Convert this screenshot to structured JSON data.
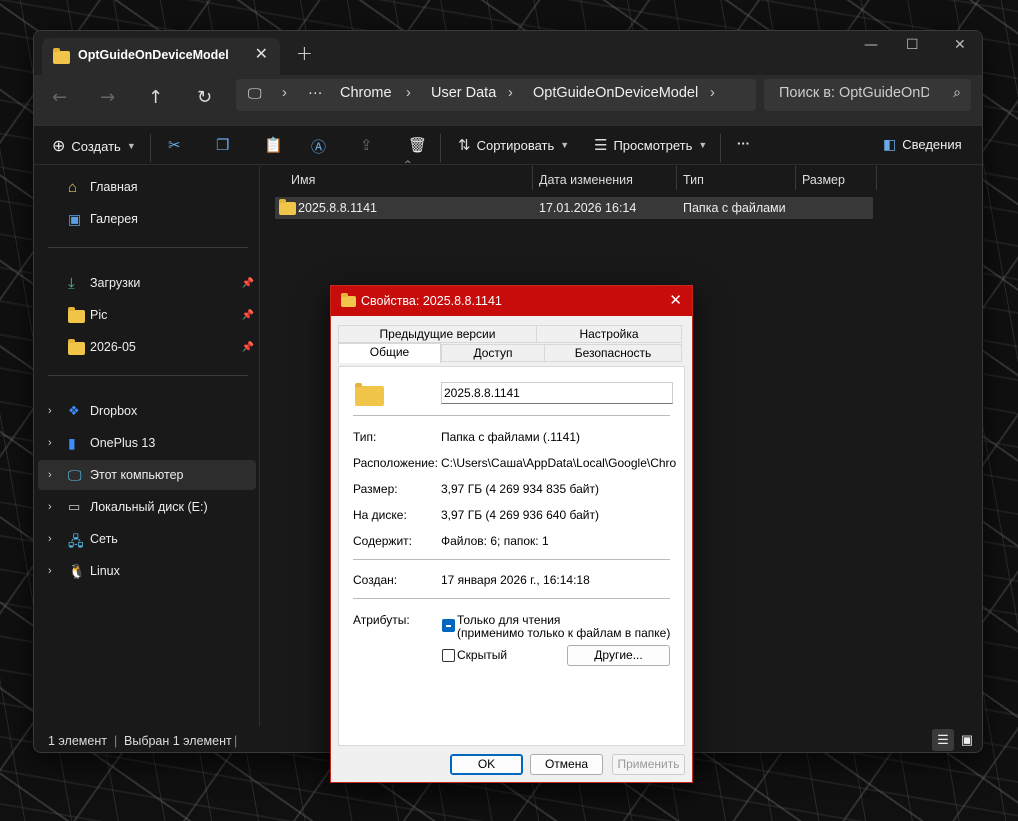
{
  "explorer": {
    "tab_title": "OptGuideOnDeviceModel",
    "new_tab": "+",
    "breadcrumb": [
      "Chrome",
      "User Data",
      "OptGuideOnDeviceModel"
    ],
    "breadcrumb_more": "···",
    "search_placeholder": "Поиск в: OptGuideOnDeviceModel",
    "toolbar": {
      "create": "Создать",
      "sort": "Сортировать",
      "view": "Просмотреть",
      "more": "···",
      "details": "Сведения"
    },
    "sidebar": {
      "pinned": [
        {
          "label": "Главная",
          "icon": "home-icon"
        },
        {
          "label": "Галерея",
          "icon": "gallery-icon"
        }
      ],
      "quick": [
        {
          "label": "Загрузки",
          "icon": "download-icon"
        },
        {
          "label": "Pic",
          "icon": "folder-icon"
        },
        {
          "label": "2026-05",
          "icon": "folder-icon"
        }
      ],
      "tree": [
        {
          "label": "Dropbox",
          "icon": "dropbox-icon"
        },
        {
          "label": "OnePlus 13",
          "icon": "phone-icon"
        },
        {
          "label": "Этот компьютер",
          "icon": "computer-icon"
        },
        {
          "label": "Локальный диск (E:)",
          "icon": "drive-icon"
        },
        {
          "label": "Сеть",
          "icon": "network-icon"
        },
        {
          "label": "Linux",
          "icon": "linux-icon"
        }
      ]
    },
    "columns": {
      "name": "Имя",
      "modified": "Дата изменения",
      "type": "Тип",
      "size": "Размер"
    },
    "files": [
      {
        "name": "2025.8.8.1141",
        "modified": "17.01.2026 16:14",
        "type": "Папка с файлами",
        "size": ""
      }
    ],
    "status": {
      "count": "1 элемент",
      "selected": "Выбран 1 элемент"
    }
  },
  "dialog": {
    "title": "Свойства: 2025.8.8.1141",
    "tabs_top": [
      "Предыдущие версии",
      "Настройка"
    ],
    "tabs_bottom": [
      "Общие",
      "Доступ",
      "Безопасность"
    ],
    "name_value": "2025.8.8.1141",
    "props": [
      {
        "label": "Тип:",
        "value": "Папка с файлами (.1141)"
      },
      {
        "label": "Расположение:",
        "value": "C:\\Users\\Саша\\AppData\\Local\\Google\\Chrome\\"
      },
      {
        "label": "Размер:",
        "value": "3,97 ГБ (4 269 934 835 байт)"
      },
      {
        "label": "На диске:",
        "value": "3,97 ГБ (4 269 936 640 байт)"
      },
      {
        "label": "Содержит:",
        "value": "Файлов: 6; папок: 1"
      }
    ],
    "created_label": "Создан:",
    "created_value": "17 января 2026 г., 16:14:18",
    "attributes_label": "Атрибуты:",
    "readonly_label": "Только для чтения",
    "readonly_note": "(применимо только к файлам в папке)",
    "hidden_label": "Скрытый",
    "other_button": "Другие...",
    "ok": "OK",
    "cancel": "Отмена",
    "apply": "Применить"
  },
  "colors": {
    "accent": "#0067c0",
    "dialog_title": "#c80c0c",
    "folder": "#f0c54a"
  }
}
